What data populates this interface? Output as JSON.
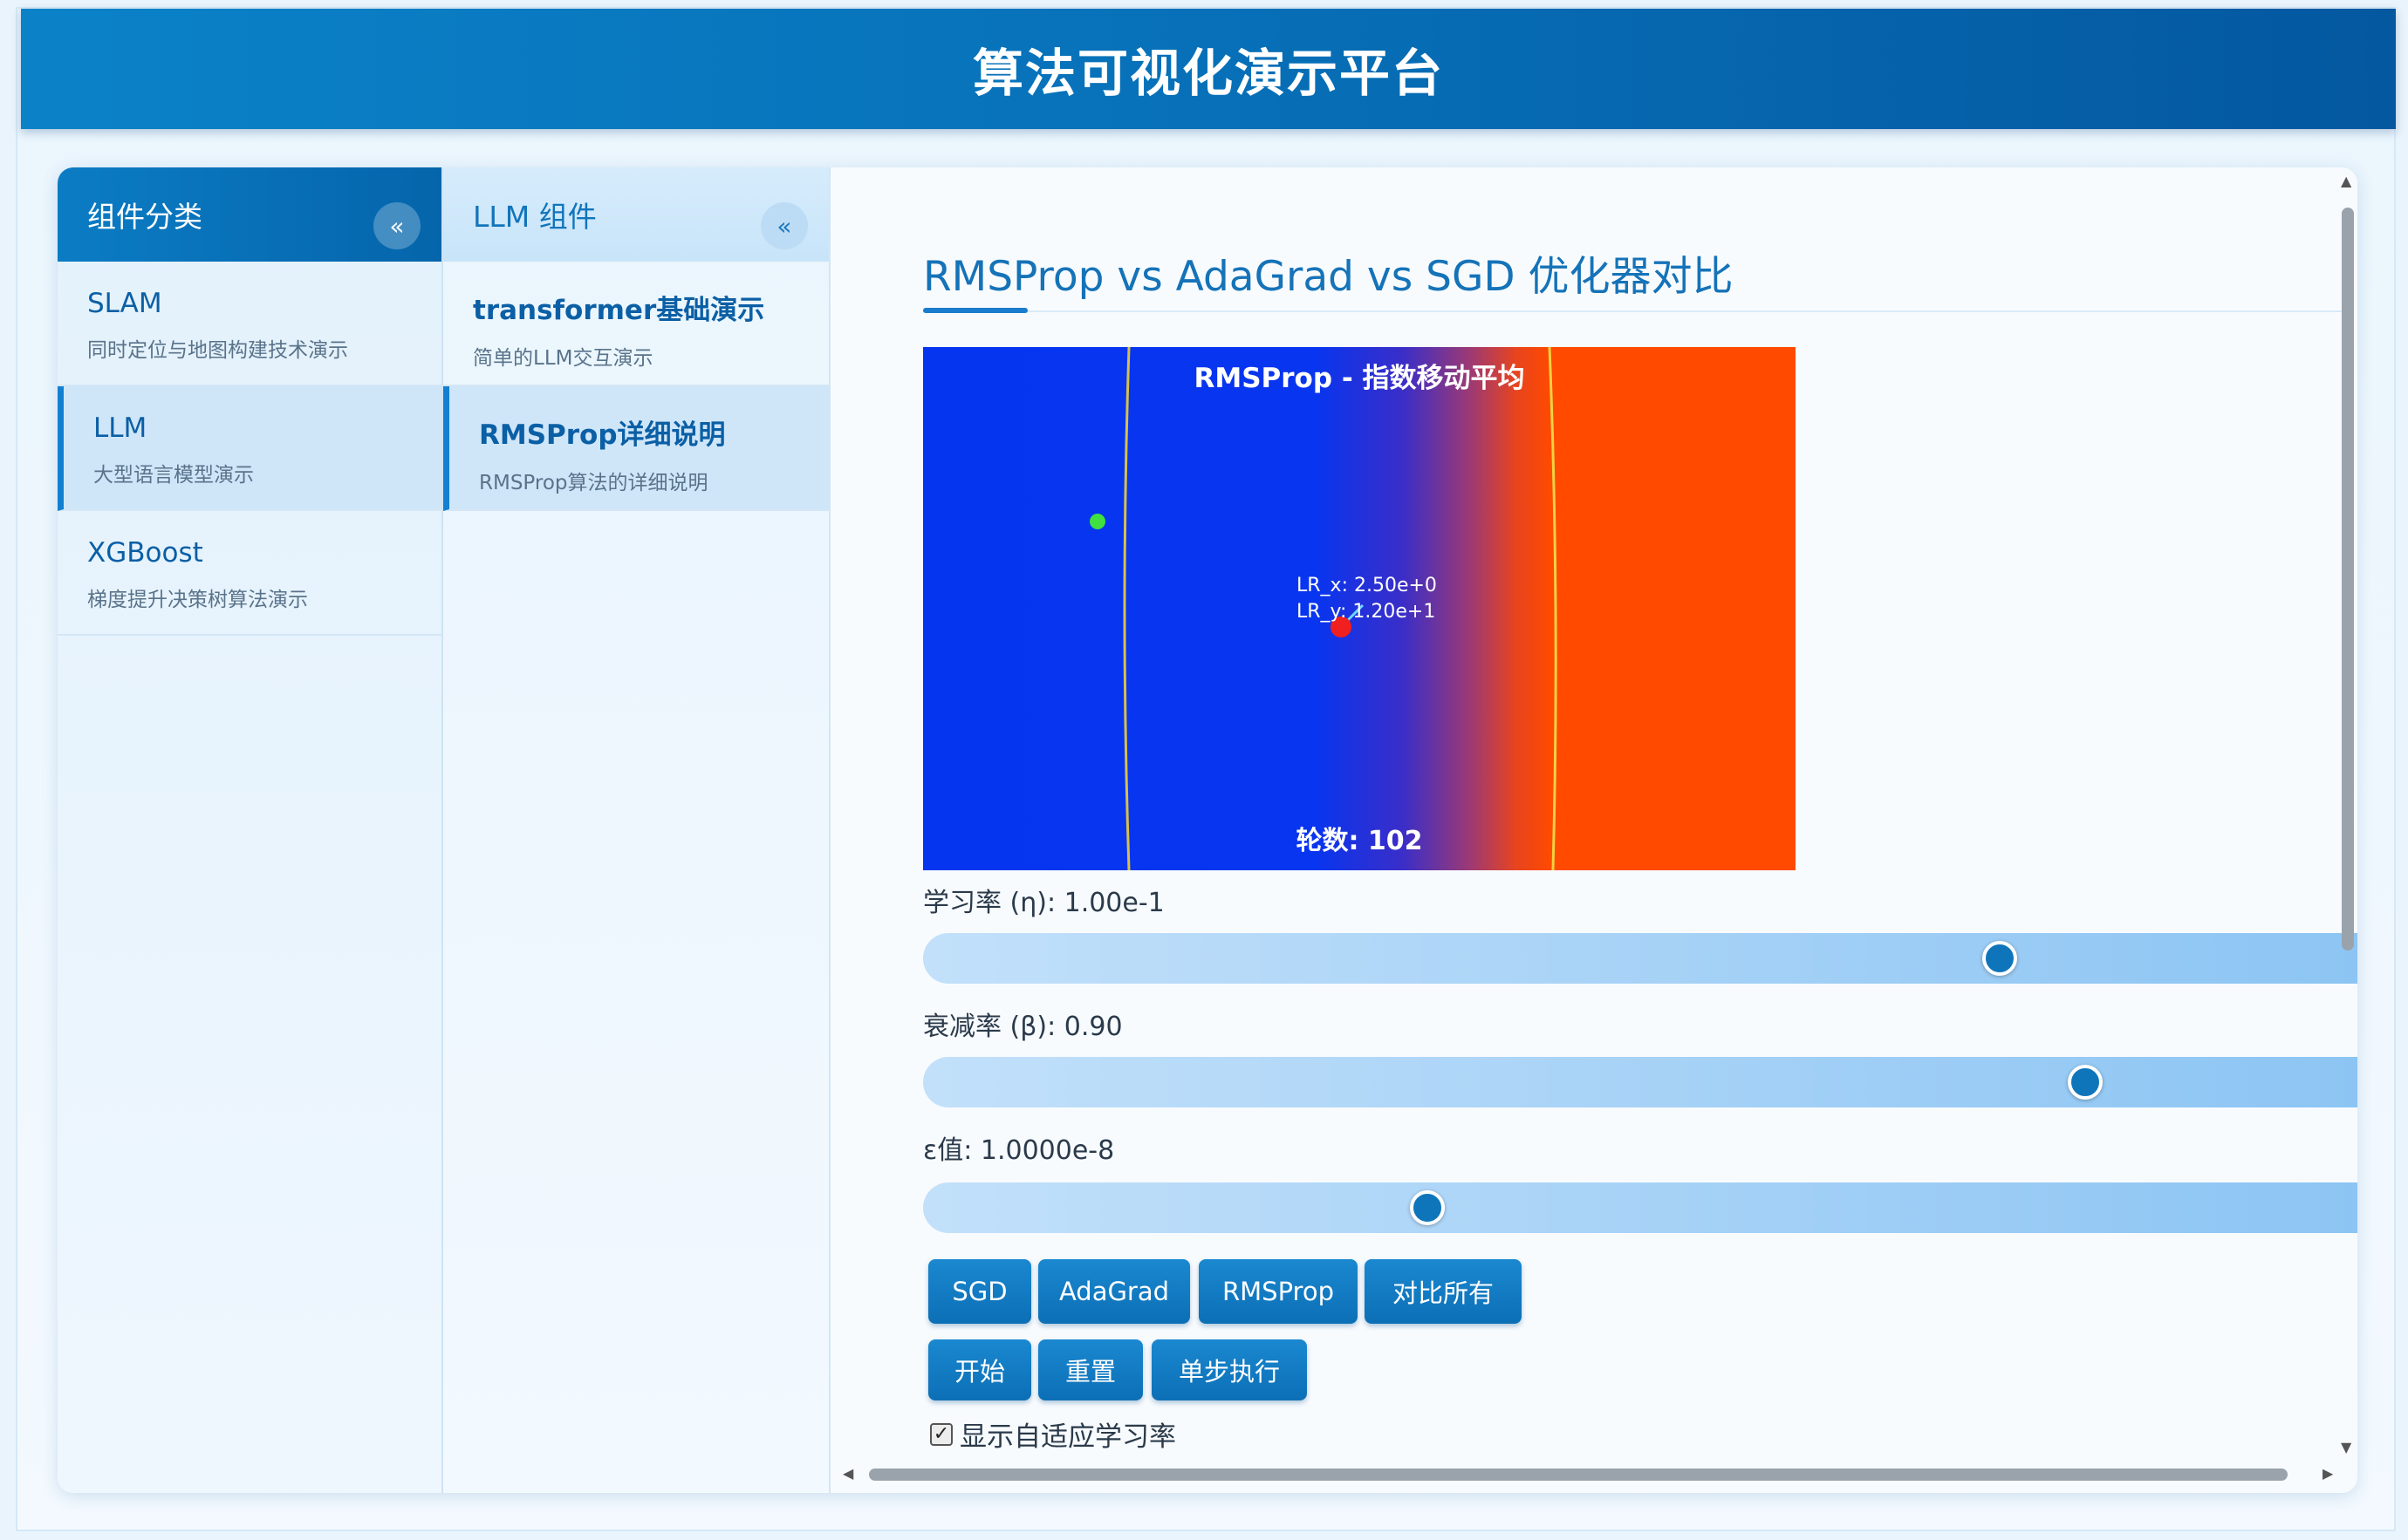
{
  "header": {
    "title": "算法可视化演示平台"
  },
  "categories": {
    "title": "组件分类",
    "collapse_label": "«",
    "items": [
      {
        "name": "SLAM",
        "desc": "同时定位与地图构建技术演示",
        "active": false
      },
      {
        "name": "LLM",
        "desc": "大型语言模型演示",
        "active": true
      },
      {
        "name": "XGBoost",
        "desc": "梯度提升决策树算法演示",
        "active": false
      }
    ]
  },
  "components": {
    "title": "LLM 组件",
    "collapse_label": "«",
    "items": [
      {
        "name": "transformer基础演示",
        "desc": "简单的LLM交互演示",
        "active": false
      },
      {
        "name": "RMSProp详细说明",
        "desc": "RMSProp算法的详细说明",
        "active": true
      }
    ]
  },
  "main": {
    "title": "RMSProp vs AdaGrad vs SGD 优化器对比",
    "canvas": {
      "title": "RMSProp - 指数移动平均",
      "lr_x": "LR_x: 2.50e+0",
      "lr_y": "LR_y: 1.20e+1",
      "epoch": "轮数: 102"
    },
    "sliders": [
      {
        "label": "学习率 (η): 1.00e-1",
        "level": 0.74
      },
      {
        "label": "衰减率 (β): 0.90",
        "level": 0.8
      },
      {
        "label": "ε值: 1.0000e-8",
        "level": 0.34
      }
    ],
    "optimizer_buttons": [
      "SGD",
      "AdaGrad",
      "RMSProp",
      "对比所有"
    ],
    "control_buttons": [
      "开始",
      "重置",
      "单步执行"
    ],
    "checkbox": {
      "label": "显示自适应学习率",
      "checked": true
    }
  },
  "colors": {
    "accent": "#0b7cc4",
    "button": "#1580c8",
    "canvas_low": "#0635f0",
    "canvas_high": "#ff4a00"
  }
}
